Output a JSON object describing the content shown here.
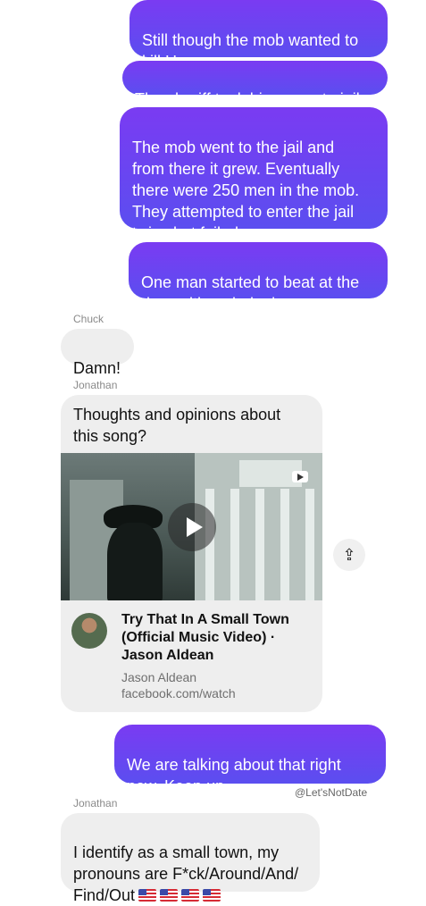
{
  "messages": [
    {
      "id": "m1",
      "text": "Still though the mob wanted to\nkill Henry."
    },
    {
      "id": "m2",
      "text": "The sheriff took him away to jail."
    },
    {
      "id": "m3",
      "text": "The mob went to the jail and\nfrom there it grew. Eventually\nthere were 250 men in the mob.\nThey attempted to enter the jail\ntwice but failed."
    },
    {
      "id": "m4",
      "text": "One man started to beat at the\ndoor with a sledgehammer."
    },
    {
      "sender": "Chuck",
      "text": "Damn!"
    },
    {
      "sender": "Jonathan",
      "text": "Thoughts and opinions about\nthis song?"
    },
    {
      "id": "m7",
      "text": "We are talking about that right\nnow. Keep up."
    },
    {
      "sender": "Jonathan",
      "text": "I identify as a small town, my\npronouns are F*ck/Around/And/\nFind/Out"
    }
  ],
  "link_preview": {
    "title": "Try That In A Small Town (Official Music Video) · Jason Aldean",
    "artist": "Jason Aldean",
    "domain": "facebook.com/watch"
  },
  "watermark": "@Let'sNotDate",
  "icons": {
    "share": "share-icon",
    "play": "play-icon",
    "video_badge": "youtube-icon",
    "flag": "us-flag-icon"
  },
  "colors": {
    "outgoing_top": "#7a3bf2",
    "outgoing_bottom": "#5b4ef0",
    "incoming": "#eeeeee"
  }
}
